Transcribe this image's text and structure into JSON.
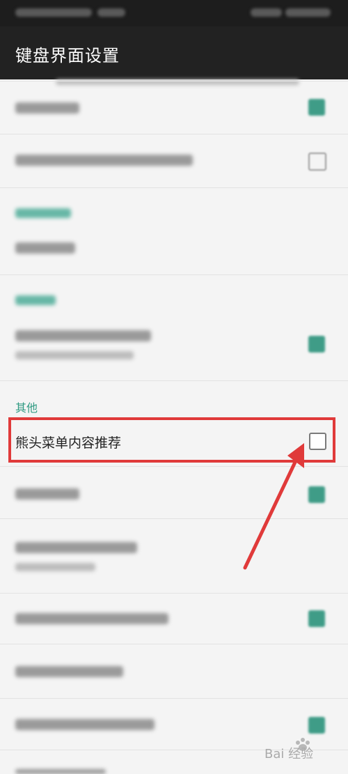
{
  "app_title": "键盘界面设置",
  "section_other": "其他",
  "setting_item": "熊头菜单内容推荐",
  "watermark_text": "Bai 经验",
  "colors": {
    "statusbar": "#1d1d1d",
    "appbar": "#222222",
    "accent": "#2f9a82",
    "checkbox_checked": "#3f9c87",
    "highlight": "#e03a3a",
    "background": "#f4f4f4"
  },
  "icons": [
    "checkbox-unchecked-icon",
    "checkbox-checked-icon",
    "annotation-arrow",
    "baidu-paw-icon"
  ]
}
